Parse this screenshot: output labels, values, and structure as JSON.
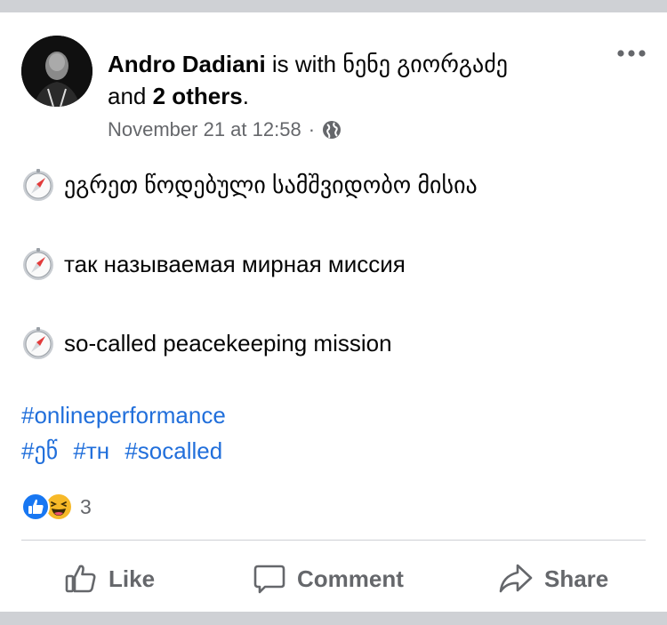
{
  "post": {
    "author": "Andro Dadiani",
    "with_text": "is with",
    "tagged": "ნენე გიორგაძე",
    "and_text": "and",
    "others": "2 others",
    "period": ".",
    "timestamp": "November 21 at 12:58",
    "separator": "·",
    "privacy_icon": "globe-icon",
    "lines": [
      {
        "icon": "compass-emoji",
        "text": "ეგრეთ წოდებული სამშვიდობო მისია"
      },
      {
        "icon": "compass-emoji",
        "text": "так называемая мирная миссия"
      },
      {
        "icon": "compass-emoji",
        "text": "so-called peacekeeping mission"
      }
    ],
    "hashtags_row1": [
      "#onlineperformance"
    ],
    "hashtags_row2": [
      "#ეწ",
      "#тн",
      "#socalled"
    ]
  },
  "reactions": {
    "icons": [
      "like-reaction-icon",
      "haha-reaction-icon"
    ],
    "count": "3"
  },
  "actions": {
    "like": "Like",
    "comment": "Comment",
    "share": "Share"
  },
  "colors": {
    "link": "#216fdb",
    "secondary_text": "#65676b",
    "like_blue": "#1877f2",
    "haha_yellow": "#f7b928"
  }
}
